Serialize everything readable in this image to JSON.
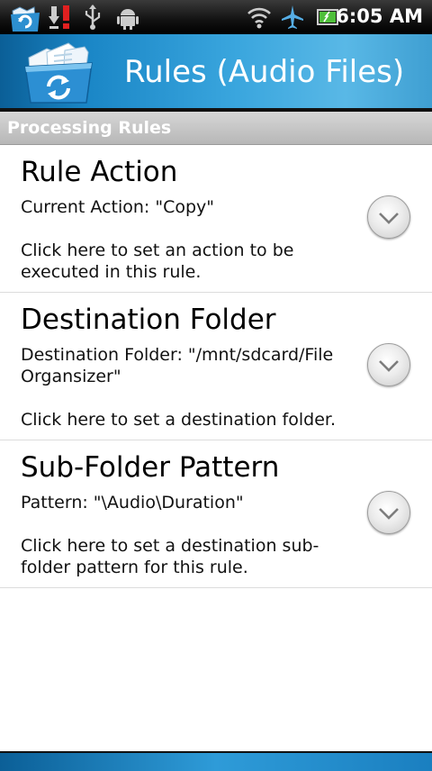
{
  "status_bar": {
    "time": "6:05 AM",
    "icons": [
      "app-notification-icon",
      "download-alert-icon",
      "usb-icon",
      "android-debug-icon",
      "wifi-icon",
      "airplane-icon",
      "battery-icon"
    ]
  },
  "app_bar": {
    "title": "Rules (Audio Files)",
    "logo": "file-organizer-logo"
  },
  "section": {
    "header": "Processing Rules"
  },
  "rules": [
    {
      "title": "Rule Action",
      "value": "Current Action: \"Copy\"",
      "description": "Click here to set an action to be executed in this rule."
    },
    {
      "title": "Destination Folder",
      "value": "Destination Folder: \"/mnt/sdcard/File Organsizer\"",
      "description": "Click here to set a destination folder."
    },
    {
      "title": "Sub-Folder Pattern",
      "value": "Pattern: \"\\Audio\\Duration\"",
      "description": "Click here to set a destination sub-folder pattern for this rule."
    }
  ],
  "colors": {
    "accent": "#1a86c6",
    "section_bg": "#c4c4c4"
  }
}
